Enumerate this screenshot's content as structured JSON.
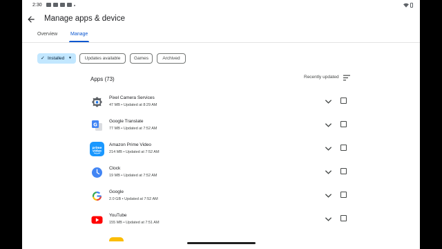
{
  "status": {
    "time": "2:30"
  },
  "header": {
    "title": "Manage apps & device"
  },
  "tabs": [
    {
      "label": "Overview"
    },
    {
      "label": "Manage"
    }
  ],
  "filters": [
    {
      "label": "Installed"
    },
    {
      "label": "Updates available"
    },
    {
      "label": "Games"
    },
    {
      "label": "Archived"
    }
  ],
  "list": {
    "title": "Apps (73)",
    "sort_label": "Recently updated",
    "apps": [
      {
        "name": "Pixel Camera Services",
        "meta": "47 MB • Updated at 8:29 AM",
        "icon": "pixel-camera-services-icon"
      },
      {
        "name": "Google Translate",
        "meta": "77 MB • Updated at 7:52 AM",
        "icon": "google-translate-icon"
      },
      {
        "name": "Amazon Prime Video",
        "meta": "214 MB • Updated at 7:52 AM",
        "icon": "prime-video-icon",
        "icon_text": "prime video"
      },
      {
        "name": "Clock",
        "meta": "19 MB • Updated at 7:52 AM",
        "icon": "clock-icon"
      },
      {
        "name": "Google",
        "meta": "2.0 GB • Updated at 7:52 AM",
        "icon": "google-icon",
        "icon_text": "G"
      },
      {
        "name": "YouTube",
        "meta": "155 MB • Updated at 7:51 AM",
        "icon": "youtube-icon"
      }
    ]
  },
  "colors": {
    "accent": "#0b57d0",
    "chip_selected": "#c2e7ff",
    "prime": "#1a98ff",
    "youtube": "#ff0000"
  }
}
